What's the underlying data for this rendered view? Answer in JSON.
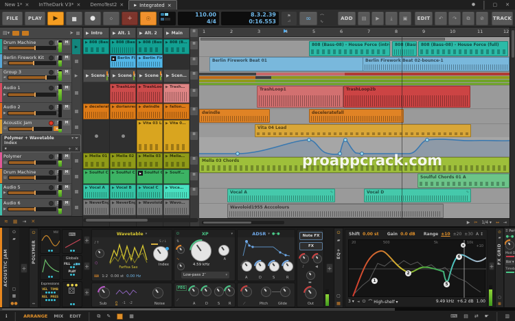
{
  "window": {
    "tabs": [
      "New 1*",
      "InTheDark V3*",
      "DemoTest2",
      "Integrated"
    ],
    "close_glyph": "×"
  },
  "transport": {
    "file": "FILE",
    "play": "PLAY",
    "add": "ADD",
    "edit": "EDIT",
    "track": "TRACK",
    "tempo": "110.00",
    "timesig": "4/4",
    "position": "8.3.2.39",
    "time": "0:16.553"
  },
  "track_controls": {
    "solo": "S",
    "mute": "M"
  },
  "tracks": [
    {
      "name": "Drum Machine",
      "color": "#1fa79b"
    },
    {
      "name": "Berlin Firework Kit",
      "color": "#58a8d8"
    },
    {
      "name": "Group 3",
      "color": "#6a6a6a"
    },
    {
      "name": "Audio 1",
      "color": "#d84a5f"
    },
    {
      "name": "Audio 2",
      "color": "#e06a1a"
    },
    {
      "name": "Acoustic Jam",
      "color": "#e0a132"
    },
    {
      "name": "Polymer",
      "color": "#e05898"
    },
    {
      "name": "Drum Machine",
      "color": "#e08428"
    },
    {
      "name": "Audio 5",
      "color": "#3fc0ad"
    },
    {
      "name": "Audio 6",
      "color": "#3fc0ad"
    }
  ],
  "device_popup": {
    "title": "Polymer + Wavetable",
    "subtitle": "Index"
  },
  "launcher": {
    "scene_headers": [
      "Intro",
      "Alt. 1",
      "Alt. 2",
      "Main"
    ],
    "drum_clips": [
      "808 (Bass-…",
      "808 (Bass-…",
      "808 (Bass-…",
      "808 (B…"
    ],
    "berlin_clips": [
      "Berlin Fire…",
      "Berlin Fire…"
    ],
    "scene_row": [
      "Scene 1",
      "Scene 2",
      "Scene 3",
      "Scen…"
    ],
    "trash_clips": [
      "TrashLoop1",
      "TrashLoop2b",
      "Trash…"
    ],
    "audio2_clips": [
      "deceleratefall",
      "dorianredu…",
      "dwindle",
      "fallon…"
    ],
    "vita_clips": [
      "Vita 03 Lead",
      "Vita 0…"
    ],
    "mella_clips": [
      "Mella 01 C…",
      "Mella 02 C…",
      "Mella 03 C…",
      "Mella…"
    ],
    "soulful_clips": [
      "Soulful Cho…",
      "Soulful Cho…",
      "Soulful Cho…",
      "Soulf…"
    ],
    "vocal_clips": [
      "Vocal A",
      "Vocal B",
      "Vocal C",
      "Voca…"
    ],
    "never_clips": [
      "NeverEngin…",
      "NeverEngin…",
      "Wavoloid1…",
      "Wavo…"
    ]
  },
  "arranger": {
    "ruler": [
      "1",
      "2",
      "3",
      "4",
      "5",
      "6",
      "7",
      "8",
      "9",
      "10",
      "11",
      "12"
    ],
    "clip_808_intro": "808 (Bass-08) - House Force (intro)",
    "clip_808_mid": "808 (Bass-08)",
    "clip_808_full": "808 (Bass-08) - House Force (full)",
    "clip_berlin1": "Berlin Firework Beat 01",
    "clip_berlin2": "Berlin Firework Beat 02-bounce-1",
    "clip_trash1": "TrashLoop1",
    "clip_trash2": "TrashLoop2b",
    "clip_dwindle": "dwindle",
    "clip_decel": "deceleratefall",
    "clip_vita": "Vita 04 Lead",
    "clip_mella": "Mella 03 Chords",
    "clip_soulful": "Soulful Chords 01 A",
    "clip_vocal_a": "Vocal A",
    "clip_vocal_d": "Vocal D",
    "clip_wavoloid": "Wavoloid1955 Acccolours",
    "watermark": "proappcrack.com",
    "snap_value": "1/4"
  },
  "device_panel": {
    "track_label": "ACOUSTIC JAM",
    "polymer": "POLYMER",
    "mod_mw": "MW",
    "mod_globals": "Globals",
    "mod_fill": "FILL",
    "mod_play": "PLAY",
    "mod_expressions": "Expressions",
    "mod_vel": "VEL",
    "mod_timb": "TIMB",
    "mod_rel": "REL",
    "mod_pres": "PRES",
    "wt_title": "Wavetable",
    "wt_name": "Farfisa Sax",
    "wt_index": "Index",
    "wt_ratio": "1:2",
    "wt_semi": "0.00 st",
    "wt_hz": "0.00 Hz",
    "wt_sub": "Sub",
    "wt_sub0": "0",
    "wt_sub1": "-1",
    "wt_sub2": "-2",
    "wt_noise": "Noise",
    "xp_title": "XP",
    "xp_freq": "4.59 kHz",
    "xp_mode": "Low-pass 2″",
    "xp_a": "A",
    "adsr_title": "ADSR",
    "env_a": "A",
    "env_d": "D",
    "env_s": "S",
    "env_r": "R",
    "feg_title": "FEG",
    "pitch": "Pitch",
    "glide": "Glide",
    "note_fx": "Note FX",
    "fx": "FX",
    "out": "Out",
    "eq_shift_label": "Shift",
    "eq_shift": "0.00 st",
    "eq_gain_label": "Gain",
    "eq_gain": "0.0 dB",
    "eq_range_label": "Range",
    "eq_r10": "±10",
    "eq_r20": "±20",
    "eq_r30": "±30",
    "eq_f20": "20",
    "eq_f500": "500",
    "eq_f5k": "5k",
    "eq_f10k": "10k",
    "eq_p10": "+10",
    "eq_b1": "1",
    "eq_b2": "2",
    "eq_b5": "5",
    "eq_b6": "6",
    "eq_count": "3",
    "eq_type": "High-shelf",
    "eq_freq": "9.49 kHz",
    "eq_band_gain": "+6.2 dB",
    "eq_q": "1.00",
    "fx_grid": "FX GRID",
    "perf_title": "Perf",
    "perf_mod": "Mod De",
    "perf_bar": "Bar",
    "perf_time": "Timeba"
  },
  "status_bar": {
    "arrange": "ARRANGE",
    "mix": "MIX",
    "edit": "EDIT"
  },
  "colors": {
    "accent_orange": "#f59d21",
    "record_red": "#e03c28",
    "display_text": "#6fb7e8",
    "meter_green": "#79c043"
  }
}
